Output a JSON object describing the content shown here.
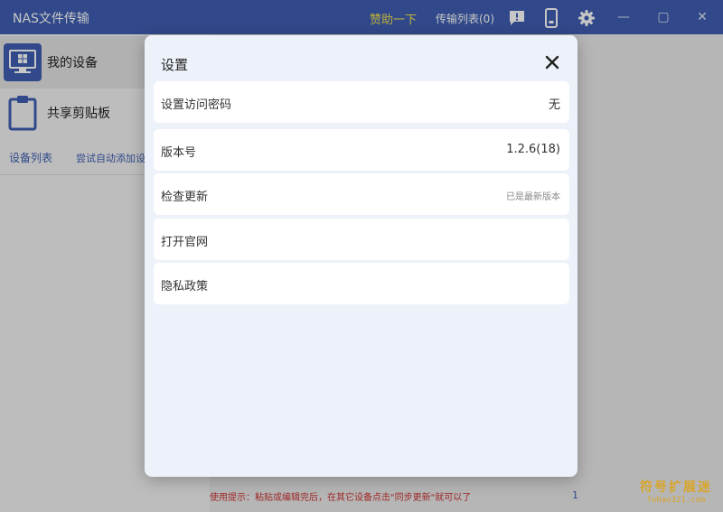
{
  "titlebar": {
    "app_title": "NAS文件传输",
    "sponsor_label": "赞助一下",
    "transfer_list_label": "传输列表(0)",
    "icons": [
      "feedback-icon",
      "phone-icon",
      "gear-icon"
    ],
    "window_controls": {
      "minimize": "—",
      "maximize": "▢",
      "close": "✕"
    },
    "colors": {
      "bar": "#3f5eb1",
      "sponsor": "#f2e24c"
    }
  },
  "sidebar": {
    "items": [
      {
        "label": "我的设备",
        "icon": "desktop-windows-icon"
      },
      {
        "label": "共享剪贴板",
        "icon": "clipboard-icon"
      }
    ],
    "links": {
      "device_list": "设备列表",
      "auto_add": "尝试自动添加设备"
    }
  },
  "main": {
    "usage_tip": "使用提示：粘贴或编辑完后，在其它设备点击\"同步更新\"就可以了",
    "edge_mark": "1"
  },
  "settings_modal": {
    "title": "设置",
    "rows": [
      {
        "label": "设置访问密码",
        "value": "无"
      },
      {
        "label": "版本号",
        "value": "1.2.6(18)"
      },
      {
        "label": "检查更新",
        "value": "已是最新版本"
      },
      {
        "label": "打开官网",
        "value": ""
      },
      {
        "label": "隐私政策",
        "value": ""
      }
    ]
  },
  "watermark": {
    "cn": "符号扩展迷",
    "url": "fuhao321.com"
  }
}
